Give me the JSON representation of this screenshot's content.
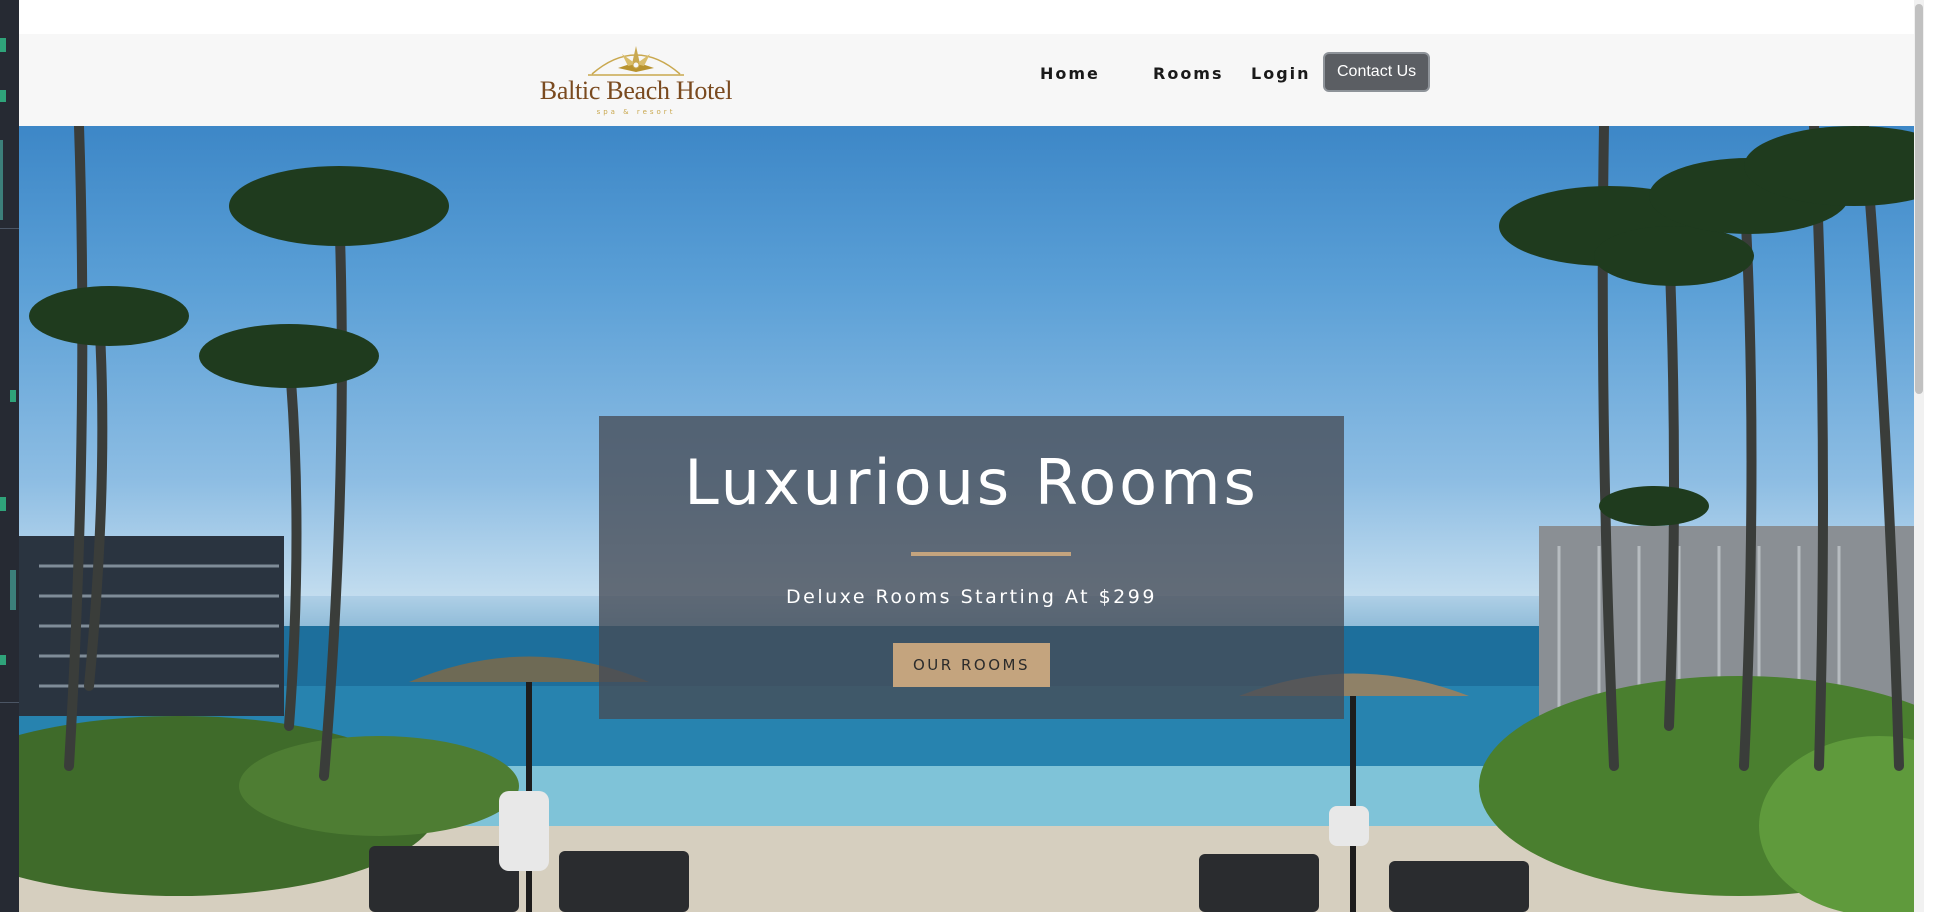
{
  "header": {
    "logo": {
      "name": "Baltic Beach Hotel",
      "tagline": "spa & resort"
    },
    "nav": {
      "home": "Home",
      "rooms": "Rooms",
      "login": "Login",
      "contact": "Contact Us"
    }
  },
  "hero": {
    "title": "Luxurious Rooms",
    "subtitle": "Deluxe Rooms Starting At $299",
    "button": "OUR ROOMS"
  },
  "colors": {
    "accent": "#c4a47e",
    "logo_brown": "#7a4a1f",
    "logo_gold": "#c9a84f",
    "contact_button": "#5b5e63",
    "header_bg": "#f7f7f7"
  },
  "icons": [
    "compass-logo-icon"
  ]
}
